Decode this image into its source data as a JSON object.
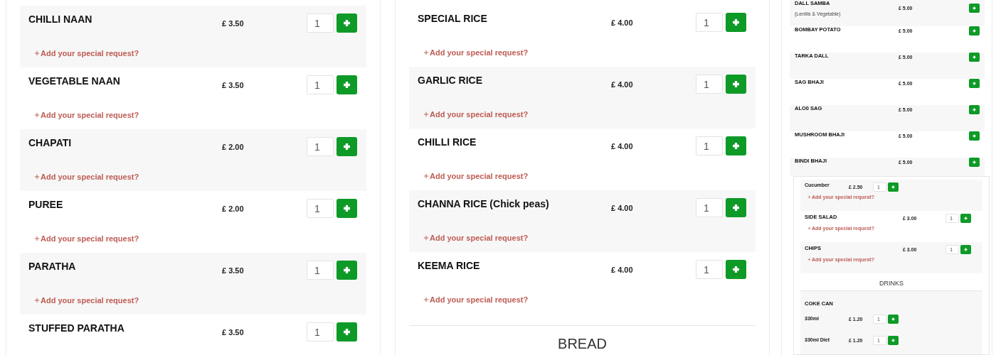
{
  "left_panel": {
    "items": [
      {
        "name": "CHILLI NAAN",
        "price": "£ 3.50",
        "quantity": "1",
        "request": "Add your special request?"
      },
      {
        "name": "VEGETABLE NAAN",
        "price": "£ 3.50",
        "quantity": "1",
        "request": "Add your special request?"
      },
      {
        "name": "CHAPATI",
        "price": "£ 2.00",
        "quantity": "1",
        "request": "Add your special request?"
      },
      {
        "name": "PUREE",
        "price": "£ 2.00",
        "quantity": "1",
        "request": "Add your special request?"
      },
      {
        "name": "PARATHA",
        "price": "£ 3.50",
        "quantity": "1",
        "request": "Add your special request?"
      },
      {
        "name": "STUFFED PARATHA",
        "price": "£ 3.50",
        "quantity": "1"
      }
    ]
  },
  "middle_panel": {
    "items": [
      {
        "name": "SPECIAL RICE",
        "price": "£ 4.00",
        "quantity": "1",
        "request": "Add your special request?"
      },
      {
        "name": "GARLIC RICE",
        "price": "£ 4.00",
        "quantity": "1",
        "request": "Add your special request?"
      },
      {
        "name": "CHILLI RICE",
        "price": "£ 4.00",
        "quantity": "1",
        "request": "Add your special request?"
      },
      {
        "name": "CHANNA RICE (Chick peas)",
        "price": "£ 4.00",
        "quantity": "1",
        "request": "Add your special request?"
      },
      {
        "name": "KEEMA RICE",
        "price": "£ 4.00",
        "quantity": "1",
        "request": "Add your special request?"
      }
    ],
    "heading": "BREAD"
  },
  "right_panel": {
    "items": [
      {
        "name": "DALL SAMBA",
        "note": "(Lentils & Vegetable)",
        "price": "£ 5.00"
      },
      {
        "name": "BOMBAY POTATO",
        "price": "£ 5.00"
      },
      {
        "name": "TARKA DALL",
        "price": "£ 5.00"
      },
      {
        "name": "SAG BHAJI",
        "price": "£ 5.00"
      },
      {
        "name": "ALO0 SAG",
        "price": "£ 5.00"
      },
      {
        "name": "MUSHROOM BHAJI",
        "price": "£ 5.00"
      },
      {
        "name": "BINDI BHAJI",
        "price": "£ 5.00"
      }
    ],
    "sub_panel": {
      "items": [
        {
          "kind": "variant",
          "name": "Cucumber",
          "price": "£ 2.50",
          "quantity": "1",
          "request": "Add your special request?"
        },
        {
          "kind": "item",
          "name": "SIDE SALAD",
          "price": "£ 3.00",
          "quantity": "1",
          "request": "Add your special request?"
        },
        {
          "kind": "item",
          "name": "CHIPS",
          "price": "£ 3.00",
          "quantity": "1",
          "request": "Add your special request?"
        }
      ],
      "heading": "DRINKS",
      "groups": [
        {
          "name": "COKE CAN",
          "variants": [
            {
              "name": "330ml",
              "price": "£ 1.20",
              "quantity": "1"
            },
            {
              "name": "330ml Diet",
              "price": "£ 1.20",
              "quantity": "1"
            }
          ]
        }
      ]
    }
  }
}
